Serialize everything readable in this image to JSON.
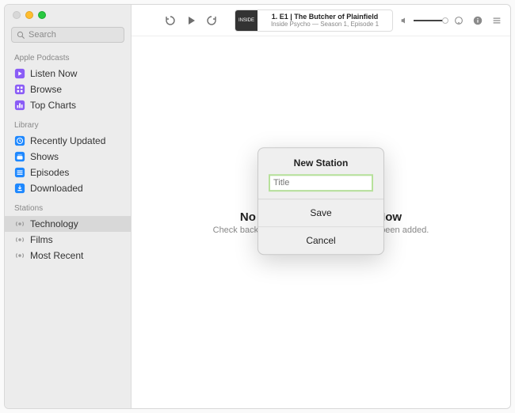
{
  "sidebar": {
    "search_placeholder": "Search",
    "sections": {
      "podcasts": {
        "label": "Apple Podcasts",
        "items": [
          "Listen Now",
          "Browse",
          "Top Charts"
        ]
      },
      "library": {
        "label": "Library",
        "items": [
          "Recently Updated",
          "Shows",
          "Episodes",
          "Downloaded"
        ]
      },
      "stations": {
        "label": "Stations",
        "items": [
          "Technology",
          "Films",
          "Most Recent"
        ],
        "selected_index": 0
      }
    }
  },
  "toolbar": {
    "now_playing": {
      "title": "1. E1 | The Butcher of Plainfield",
      "subtitle": "Inside Psycho — Season 1, Episode 1"
    }
  },
  "content": {
    "empty_title": "No New Episodes Right Now",
    "empty_subtitle": "Check back later when new episodes have been added."
  },
  "modal": {
    "title": "New Station",
    "input_placeholder": "Title",
    "save_label": "Save",
    "cancel_label": "Cancel"
  }
}
